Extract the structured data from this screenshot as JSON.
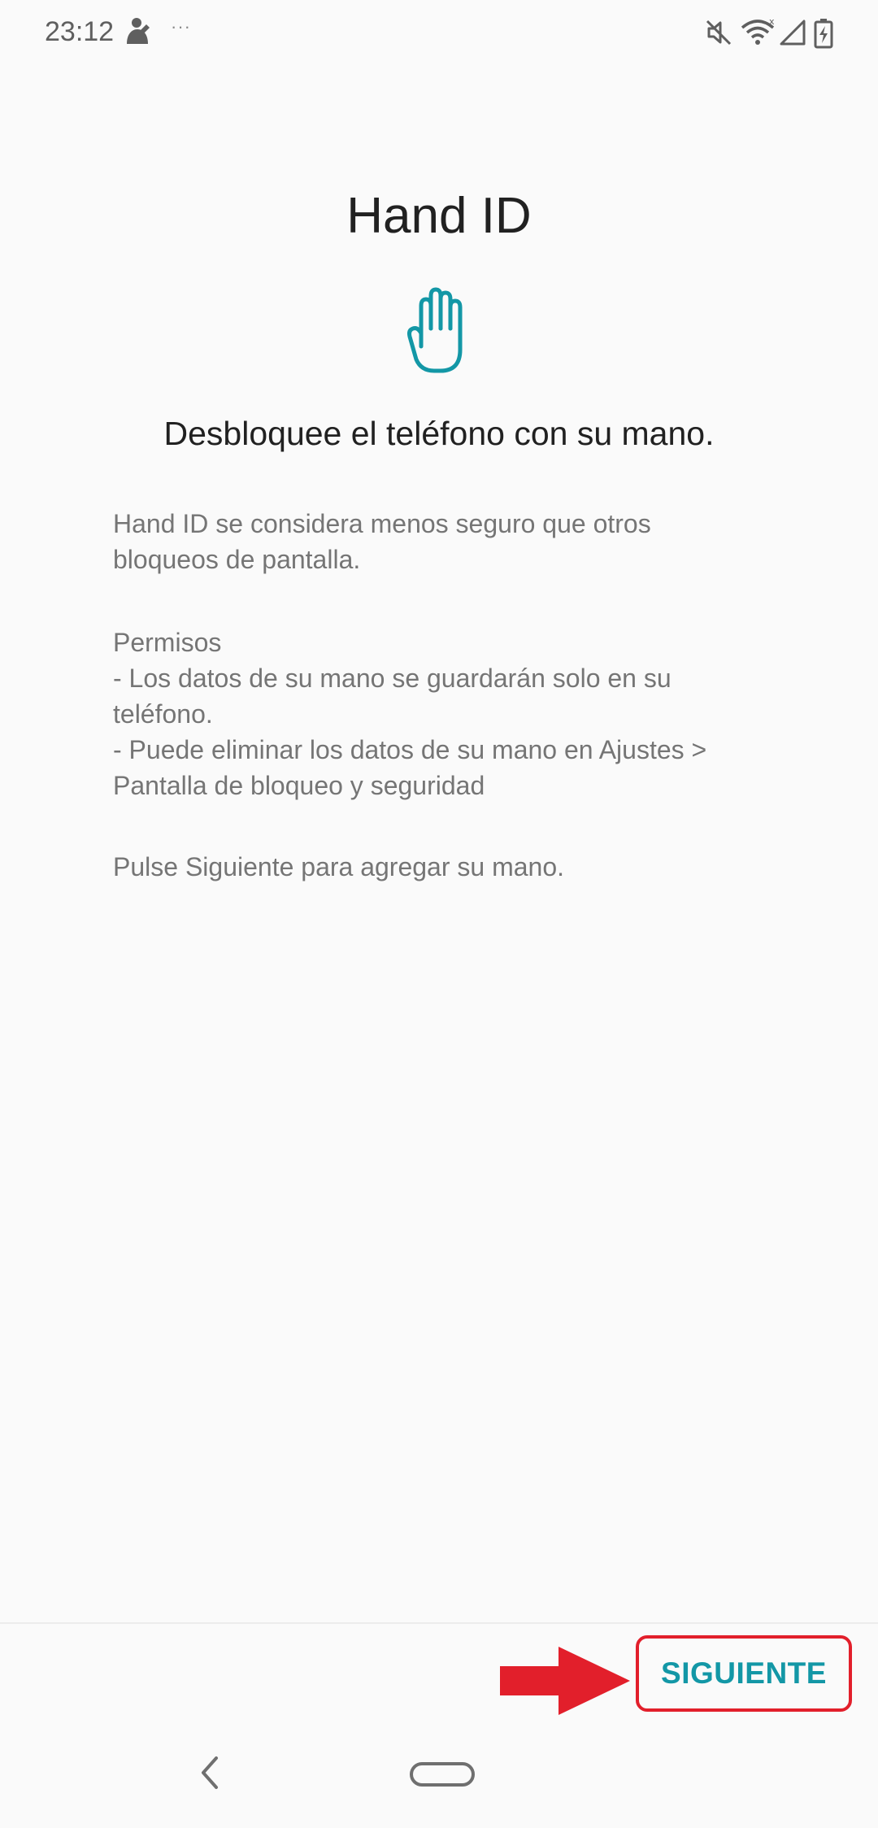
{
  "status_bar": {
    "time": "23:12",
    "notification_icon": "person-icon",
    "more_indicator": "···",
    "right_icons": [
      "mute-icon",
      "wifi-icon",
      "cell-signal-icon",
      "battery-charging-icon"
    ]
  },
  "header": {
    "title": "Hand ID",
    "icon": "hand-icon",
    "subtitle": "Desbloquee el teléfono con su mano."
  },
  "body": {
    "paragraph_1_line_1": "Hand ID se considera menos seguro que otros",
    "paragraph_1_line_2": "bloqueos de pantalla.",
    "permissions_title": "Permisos",
    "permission_1_line_1": "- Los datos de su mano se guardarán solo en su",
    "permission_1_line_2": "teléfono.",
    "permission_2_line_1": "- Puede eliminar los datos de su mano en Ajustes >",
    "permission_2_line_2": "Pantalla de bloqueo y seguridad",
    "instruction": "Pulse Siguiente para agregar su mano."
  },
  "footer": {
    "next_label": "SIGUIENTE"
  },
  "colors": {
    "accent": "#1397a6",
    "annotation": "#e21f2b",
    "text_primary": "#212121",
    "text_secondary": "#757575",
    "background": "#fafafa"
  },
  "nav": {
    "back_icon": "back-chevron-icon",
    "home_icon": "home-pill-icon"
  }
}
